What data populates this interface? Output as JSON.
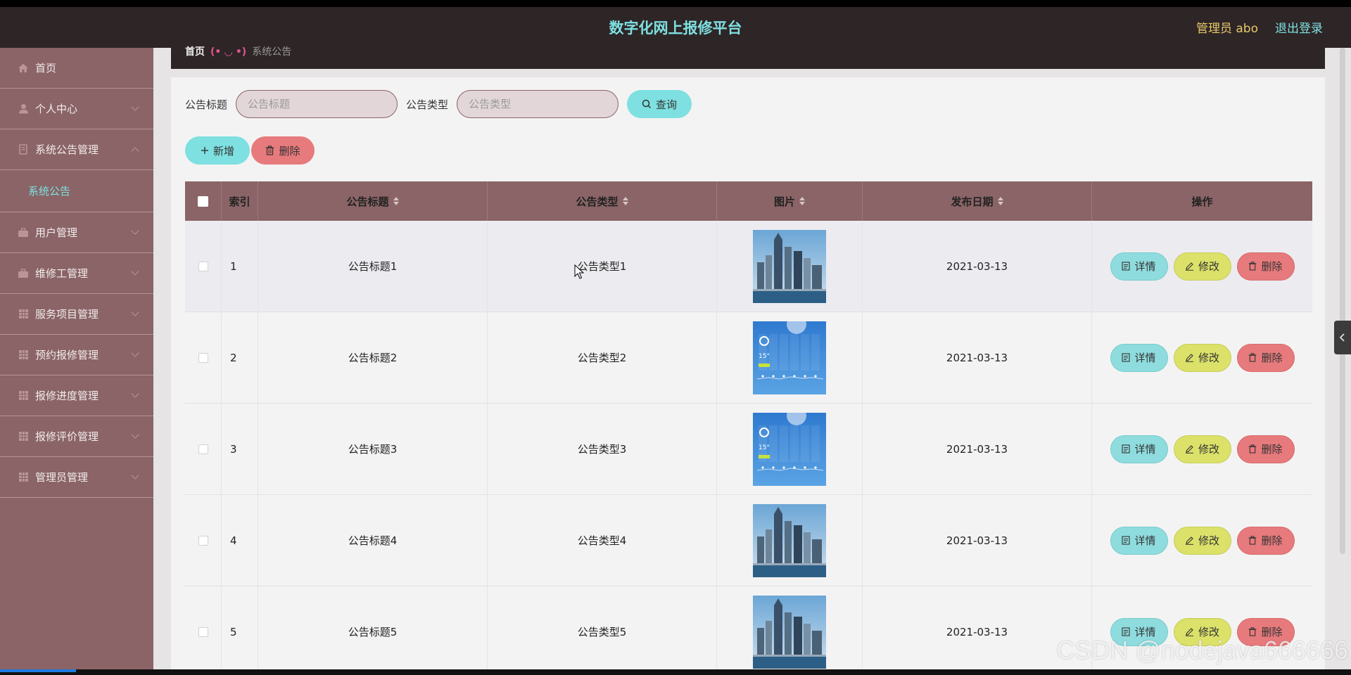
{
  "header": {
    "title": "数字化网上报修平台",
    "admin": "管理员 abo",
    "logout": "退出登录"
  },
  "sidebar": {
    "items": [
      {
        "label": "首页",
        "icon": "home-icon",
        "expandable": false
      },
      {
        "label": "个人中心",
        "icon": "user-icon",
        "expandable": true
      },
      {
        "label": "系统公告管理",
        "icon": "document-icon",
        "expandable": true,
        "open": true
      },
      {
        "label": "用户管理",
        "icon": "briefcase-icon",
        "expandable": true
      },
      {
        "label": "维修工管理",
        "icon": "briefcase-icon",
        "expandable": true
      },
      {
        "label": "服务项目管理",
        "icon": "grid-icon",
        "expandable": true
      },
      {
        "label": "预约报修管理",
        "icon": "grid-icon",
        "expandable": true
      },
      {
        "label": "报修进度管理",
        "icon": "grid-icon",
        "expandable": true
      },
      {
        "label": "报修评价管理",
        "icon": "grid-icon",
        "expandable": true
      },
      {
        "label": "管理员管理",
        "icon": "grid-icon",
        "expandable": true
      }
    ],
    "submenu": {
      "label": "系统公告"
    }
  },
  "breadcrumb": {
    "home": "首页",
    "separator": "(• ◡ •)",
    "current": "系统公告"
  },
  "search": {
    "title_label": "公告标题",
    "title_placeholder": "公告标题",
    "type_label": "公告类型",
    "type_placeholder": "公告类型",
    "query_label": "查询"
  },
  "actions": {
    "add_label": "新增",
    "delete_label": "删除"
  },
  "table": {
    "headers": {
      "index": "索引",
      "title": "公告标题",
      "type": "公告类型",
      "image": "图片",
      "date": "发布日期",
      "ops": "操作"
    },
    "rows": [
      {
        "index": "1",
        "title": "公告标题1",
        "type": "公告类型1",
        "image": "city",
        "date": "2021-03-13"
      },
      {
        "index": "2",
        "title": "公告标题2",
        "type": "公告类型2",
        "image": "weather",
        "date": "2021-03-13"
      },
      {
        "index": "3",
        "title": "公告标题3",
        "type": "公告类型3",
        "image": "weather",
        "date": "2021-03-13"
      },
      {
        "index": "4",
        "title": "公告标题4",
        "type": "公告类型4",
        "image": "city",
        "date": "2021-03-13"
      },
      {
        "index": "5",
        "title": "公告标题5",
        "type": "公告类型5",
        "image": "city",
        "date": "2021-03-13"
      }
    ],
    "ops": {
      "detail": "详情",
      "edit": "修改",
      "delete": "删除"
    }
  },
  "watermark": "CSDN @nodejava666666",
  "colors": {
    "header_bg": "#2e2526",
    "sidebar_bg": "#8a6466",
    "accent_cyan": "#7ee0e0",
    "accent_yellow": "#dbe169",
    "accent_red": "#e77a7c",
    "admin_gold": "#e6c96a"
  }
}
